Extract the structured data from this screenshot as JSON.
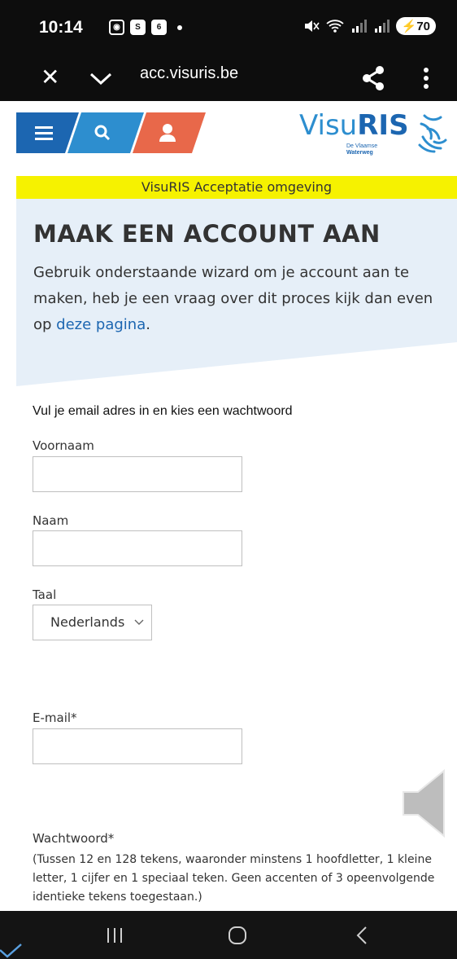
{
  "status_bar": {
    "time": "10:14",
    "notification_badge": "6",
    "battery": "70",
    "icons": [
      "screen-record-icon",
      "s-app-icon",
      "calendar-icon",
      "mute-icon",
      "wifi-icon",
      "signal-icon",
      "signal-icon"
    ]
  },
  "browser": {
    "url": "acc.visuris.be",
    "icons": [
      "close-icon",
      "chevron-down-icon",
      "share-icon",
      "more-vert-icon"
    ]
  },
  "header": {
    "logo_prefix": "Visu",
    "logo_suffix": "RIS",
    "logo_sub_1": "De Vlaamse",
    "logo_sub_2": "Waterweg",
    "nav_icons": [
      "menu-icon",
      "search-icon",
      "user-icon"
    ],
    "colors": {
      "nav_blue": "#1c66b1",
      "search_blue": "#2d8ecf",
      "user_orange": "#e8684a"
    }
  },
  "banner": {
    "text": "VisuRIS Acceptatie omgeving",
    "color": "#f6f200"
  },
  "hero": {
    "title": "MAAK EEN ACCOUNT AAN",
    "text_before_link": "Gebruik onderstaande wizard  om je account aan te maken, heb je een vraag over dit proces kijk dan even op ",
    "link_text": "deze pagina",
    "text_after_link": ".",
    "background_color": "#e6eff8"
  },
  "form": {
    "intro": "Vul je email adres in en kies een wachtwoord",
    "firstname_label": "Voornaam",
    "firstname_value": "",
    "name_label": "Naam",
    "name_value": "",
    "language_label": "Taal",
    "language_value": "Nederlands",
    "email_label": "E-mail*",
    "email_value": "",
    "password_label": "Wachtwoord*",
    "password_help": "(Tussen 12 en 128 tekens, waaronder minstens 1 hoofdletter, 1 kleine letter, 1 cijfer en 1 speciaal teken. Geen accenten of 3 opeenvolgende identieke tekens toegestaan.)"
  },
  "system_nav": {
    "icons": [
      "recent-apps-icon",
      "home-icon",
      "back-icon"
    ]
  }
}
